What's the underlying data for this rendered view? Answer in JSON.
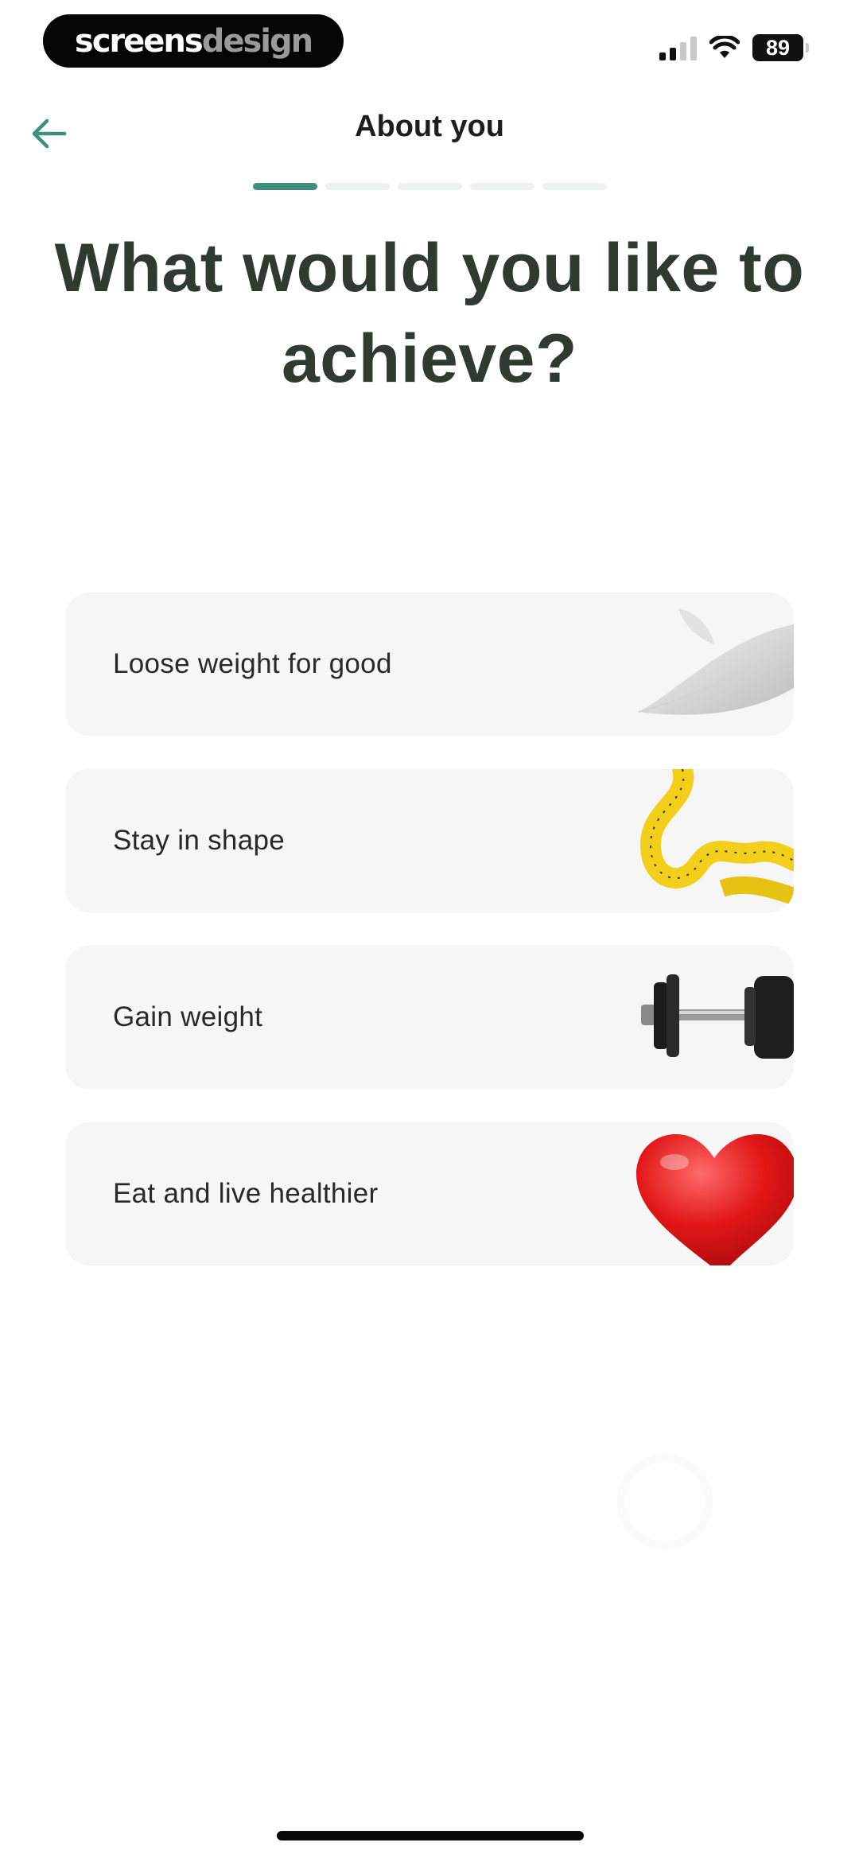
{
  "status_bar": {
    "brand_part1": "screens",
    "brand_part2": "design",
    "battery": "89"
  },
  "header": {
    "title": "About you",
    "progress_step": 1,
    "progress_total": 5
  },
  "question": "What would you like to achieve?",
  "options": [
    {
      "label": "Loose weight for good",
      "icon": "feather-icon"
    },
    {
      "label": "Stay in shape",
      "icon": "measuring-tape-icon"
    },
    {
      "label": "Gain weight",
      "icon": "dumbbell-icon"
    },
    {
      "label": "Eat and live healthier",
      "icon": "heart-icon"
    }
  ],
  "colors": {
    "accent": "#3f8f7b",
    "heading": "#2f3a30",
    "card_background": "#f6f6f6"
  }
}
